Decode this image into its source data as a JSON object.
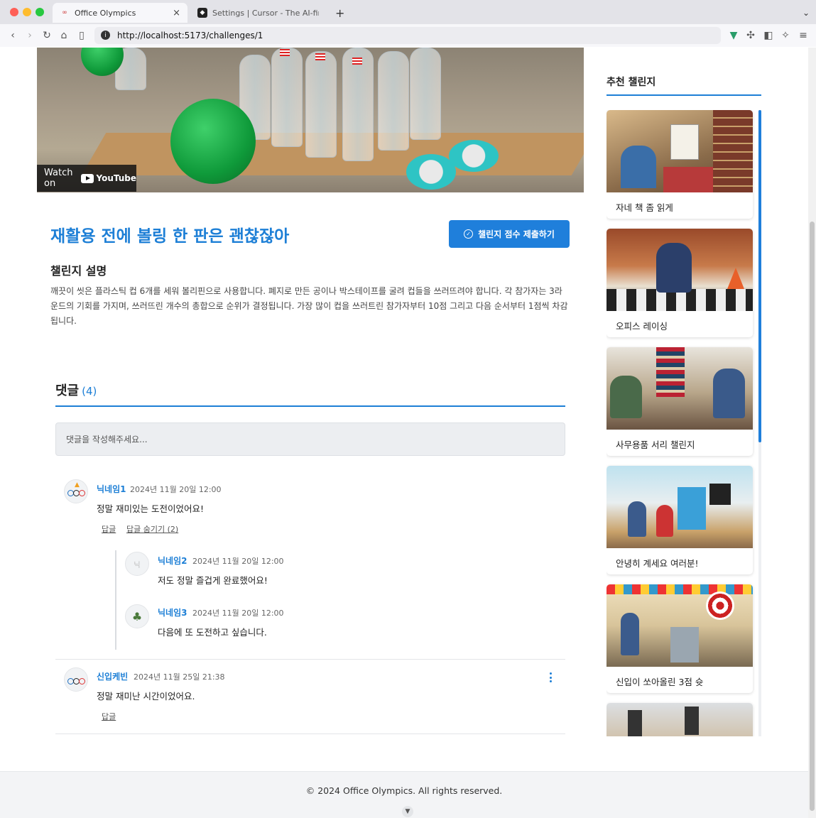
{
  "browser": {
    "tabs": [
      {
        "title": "Office Olympics",
        "active": true
      },
      {
        "title": "Settings | Cursor - The AI-first Co",
        "active": false
      }
    ],
    "url": "http://localhost:5173/challenges/1",
    "new_tab_label": "+",
    "close_label": "×"
  },
  "video": {
    "watch_on": "Watch on",
    "youtube": "YouTube"
  },
  "challenge": {
    "title": "재활용 전에 볼링 한 판은 괜찮잖아",
    "submit_label": "챌린지 점수 제출하기",
    "description_heading": "챌린지 설명",
    "description": "깨끗이 씻은 플라스틱 컵 6개를 세워 볼리핀으로 사용합니다. 폐지로 만든 공이나 박스테이프를 굴려 컵들을 쓰러뜨려야 합니다. 각 참가자는 3라운드의 기회를 가지며, 쓰러뜨린 개수의 총합으로 순위가 결정됩니다. 가장 많이 컵을 쓰러트린 참가자부터 10점 그리고 다음 순서부터 1점씩 차감됩니다."
  },
  "comments": {
    "heading": "댓글",
    "count": "(4)",
    "placeholder": "댓글을 작성해주세요...",
    "items": [
      {
        "nickname": "닉네임1",
        "date": "2024년 11월 20일 12:00",
        "text": "정말 재미있는 도전이었어요!",
        "reply_label": "답글",
        "toggle_label": "답글 숨기기 (2)",
        "replies": [
          {
            "nickname": "닉네임2",
            "date": "2024년 11월 20일 12:00",
            "text": "저도 정말 즐겁게 완료했어요!",
            "avatar_initial": "닉"
          },
          {
            "nickname": "닉네임3",
            "date": "2024년 11월 20일 12:00",
            "text": "다음에 또 도전하고 싶습니다."
          }
        ]
      },
      {
        "nickname": "신입케빈",
        "date": "2024년 11월 25일 21:38",
        "text": "정말 재미난 시간이었어요.",
        "reply_label": "답글"
      }
    ]
  },
  "sidebar": {
    "heading": "추천 챌린지",
    "cards": [
      {
        "label": "자네 책 좀 읽게"
      },
      {
        "label": "오피스 레이싱"
      },
      {
        "label": "사무용품 서리 챌린지"
      },
      {
        "label": "안녕히 계세요 여러분!"
      },
      {
        "label": "신입이 쏘아올린 3점 슛"
      },
      {
        "label": ""
      }
    ]
  },
  "footer": {
    "copyright": "© 2024 Office Olympics. All rights reserved."
  },
  "colors": {
    "accent": "#1d7fd6",
    "button": "#1f7fdb"
  }
}
